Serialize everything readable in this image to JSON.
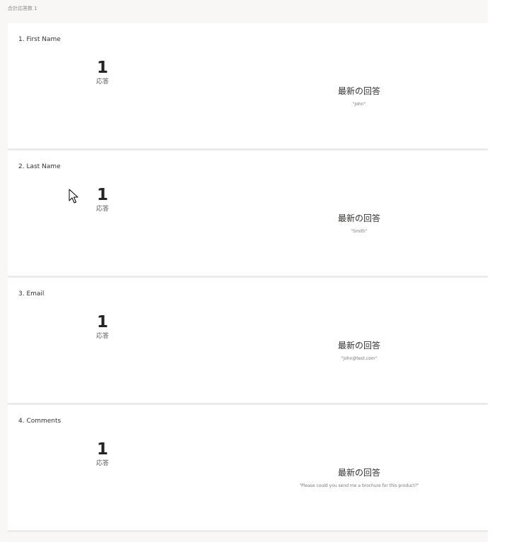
{
  "header": {
    "total_responses": "合計応答数 1"
  },
  "questions": [
    {
      "title": "1. First Name",
      "count": "1",
      "count_label": "応答",
      "latest_title": "最新の回答",
      "latest_value": "\"John\""
    },
    {
      "title": "2. Last Name",
      "count": "1",
      "count_label": "応答",
      "latest_title": "最新の回答",
      "latest_value": "\"Smith\""
    },
    {
      "title": "3. Email",
      "count": "1",
      "count_label": "応答",
      "latest_title": "最新の回答",
      "latest_value": "\"john@test.com\""
    },
    {
      "title": "4. Comments",
      "count": "1",
      "count_label": "応答",
      "latest_title": "最新の回答",
      "latest_value": "\"Please could you send me a brochure for this product?\""
    }
  ],
  "cursor": {
    "icon": "mouse-pointer-icon"
  }
}
